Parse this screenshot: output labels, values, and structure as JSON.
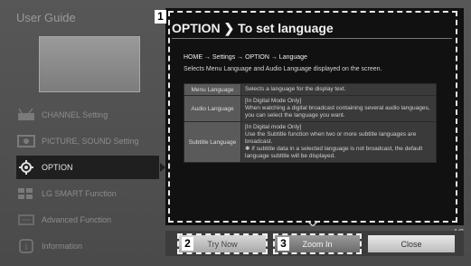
{
  "sidebar": {
    "title": "User Guide",
    "items": [
      {
        "label": "CHANNEL Setting",
        "icon": "antenna-icon"
      },
      {
        "label": "PICTURE, SOUND Setting",
        "icon": "picture-sound-icon"
      },
      {
        "label": "OPTION",
        "icon": "gear-icon",
        "active": true
      },
      {
        "label": "LG SMART Function",
        "icon": "smart-function-icon"
      },
      {
        "label": "Advanced Function",
        "icon": "advanced-function-icon"
      },
      {
        "label": "Information",
        "icon": "info-icon"
      }
    ]
  },
  "main": {
    "title": "OPTION ❯ To set language",
    "path": "HOME → Settings → OPTION → Language",
    "description": "Selects Menu Language and Audio Language displayed on the screen.",
    "table": [
      {
        "key": "Menu Language",
        "value": "Selects a language for the display text."
      },
      {
        "key": "Audio Language",
        "value": "[In Digital Mode Only]\nWhen watching a digital broadcast containing several audio languages, you can select the language you want."
      },
      {
        "key": "Subtitle Language",
        "value": "[In Digital mode Only]\nUse the Subtitle function when two or more subtitle languages are broadcast.\n✱ If subtitle data in a selected language is not broadcast, the default language subtitle will be displayed."
      }
    ]
  },
  "pagination": "1/2",
  "buttons": {
    "try_now": "Try Now",
    "zoom_in": "Zoom In",
    "close": "Close"
  },
  "callouts": [
    "1",
    "2",
    "3"
  ]
}
